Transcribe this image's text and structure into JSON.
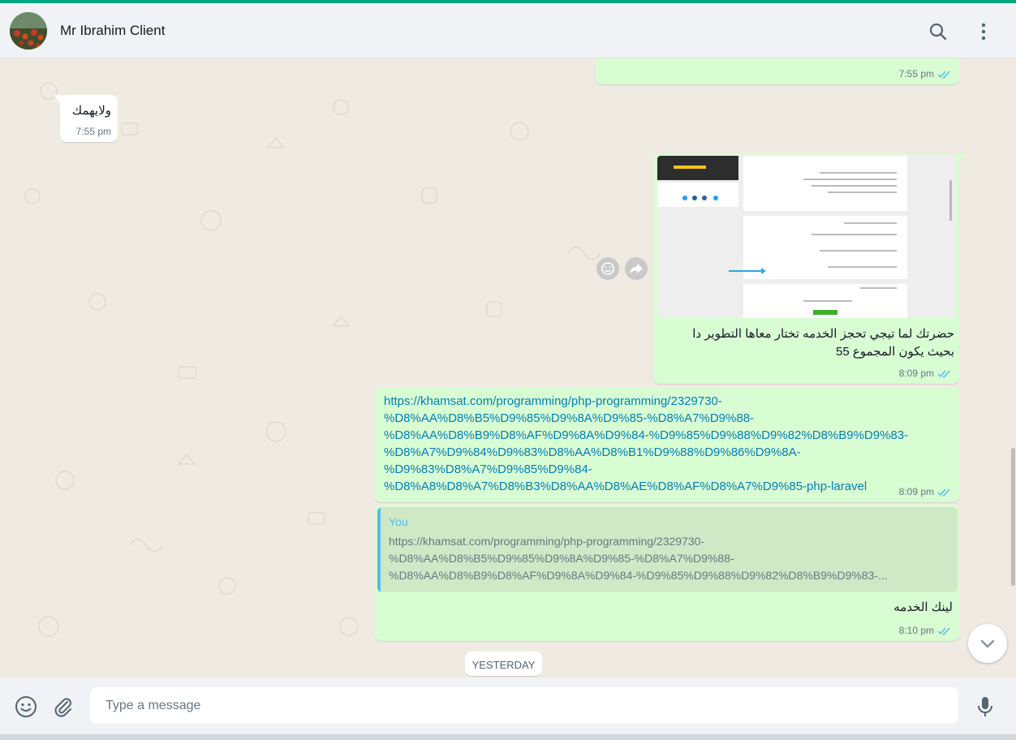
{
  "header": {
    "contact_name": "Mr Ibrahim Client",
    "icons": [
      "search-icon",
      "menu-dots-icon"
    ]
  },
  "messages": {
    "m1": {
      "time": "7:55 pm",
      "direction": "outgoing",
      "status": "read"
    },
    "m2": {
      "text": "ولايهمك",
      "time": "7:55 pm",
      "direction": "incoming"
    },
    "m3": {
      "caption_line1": "حضرتك لما تيجي تحجز الخدمه تختار معاها التطوير دا",
      "caption_line2": "بحيث يكون المجموع 55",
      "time": "8:09 pm",
      "direction": "outgoing",
      "status": "read",
      "hover_icons": [
        "emoji-react-icon",
        "forward-icon"
      ]
    },
    "m4": {
      "link_lines": [
        "https://khamsat.com/programming/php-programming/2329730-",
        "%D8%AA%D8%B5%D9%85%D9%8A%D9%85-%D8%A7%D9%88-",
        "%D8%AA%D8%B9%D8%AF%D9%8A%D9%84-%D9%85%D9%88%D9%82%D8%B9%D9%83-",
        "%D8%A7%D9%84%D9%83%D8%AA%D8%B1%D9%88%D9%86%D9%8A-",
        "%D9%83%D8%A7%D9%85%D9%84-",
        "%D8%A8%D8%A7%D8%B3%D8%AA%D8%AE%D8%AF%D8%A7%D9%85-php-laravel"
      ],
      "time": "8:09 pm",
      "direction": "outgoing",
      "status": "read"
    },
    "m5": {
      "quote_author": "You",
      "quote_lines": [
        "https://khamsat.com/programming/php-programming/2329730-",
        "%D8%AA%D8%B5%D9%85%D9%8A%D9%85-%D8%A7%D9%88-",
        "%D8%AA%D8%B9%D8%AF%D9%8A%D9%84-%D9%85%D9%88%D9%82%D8%B9%D9%83-..."
      ],
      "text": "لينك الخدمه",
      "time": "8:10 pm",
      "direction": "outgoing",
      "status": "read"
    }
  },
  "date_divider": "YESTERDAY",
  "composer": {
    "placeholder": "Type a message",
    "icons": [
      "emoji-icon",
      "attach-icon",
      "mic-icon"
    ]
  },
  "colors": {
    "outgoing_bubble": "#d9fdd3",
    "incoming_bubble": "#ffffff",
    "link": "#027eb5",
    "read_ticks": "#53bdeb",
    "accent": "#00a884"
  }
}
